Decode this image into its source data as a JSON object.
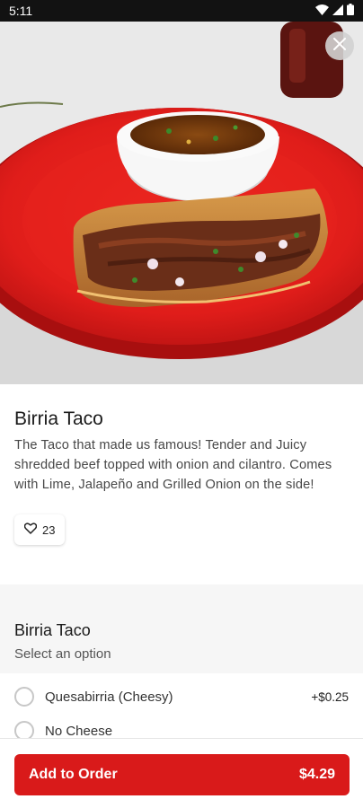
{
  "status_bar": {
    "time": "5:11"
  },
  "item": {
    "name": "Birria Taco",
    "description": "The Taco that made us famous! Tender and Juicy shredded beef topped with onion and cilantro. Comes with Lime, Jalapeño and Grilled Onion on the side!",
    "likes": "23"
  },
  "options": {
    "title": "Birria Taco",
    "subtitle": "Select an option",
    "choices": [
      {
        "label": "Quesabirria (Cheesy)",
        "price": "+$0.25"
      },
      {
        "label": "No Cheese",
        "price": ""
      }
    ]
  },
  "cart": {
    "button_label": "Add to Order",
    "total": "$4.29"
  },
  "colors": {
    "accent": "#d91a1a",
    "plate": "#e01f1f"
  },
  "icons": [
    "wifi-icon",
    "cellular-icon",
    "battery-icon",
    "close-icon",
    "heart-icon"
  ]
}
